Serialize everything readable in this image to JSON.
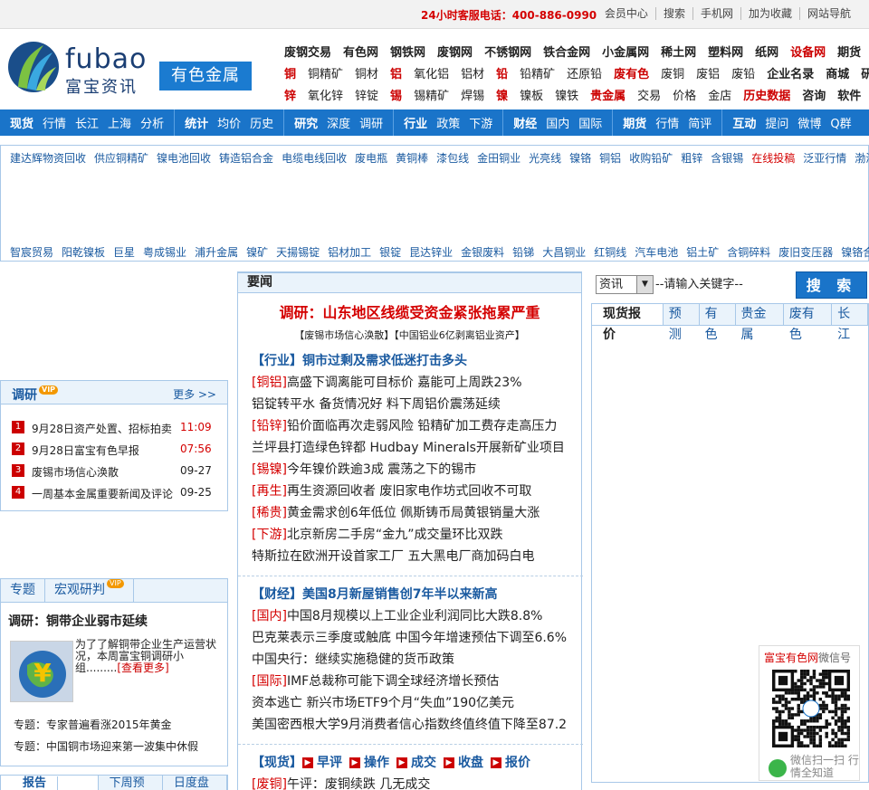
{
  "topbar": {
    "hotline": "24小时客服电话：400-886-0990",
    "links": [
      "会员中心",
      "搜索",
      "手机网",
      "加为收藏",
      "网站导航"
    ]
  },
  "logo": {
    "latin": "fubao",
    "chinese": "富宝资讯",
    "badge": "有色金属"
  },
  "topnav": {
    "row1": [
      {
        "t": "废钢交易",
        "s": "b"
      },
      {
        "t": "有色网",
        "s": "b"
      },
      {
        "t": "钢铁网",
        "s": "b"
      },
      {
        "t": "废钢网",
        "s": "b"
      },
      {
        "t": "不锈钢网",
        "s": "b"
      },
      {
        "t": "铁合金网",
        "s": "b"
      },
      {
        "t": "小金属网",
        "s": "b"
      },
      {
        "t": "稀土网",
        "s": "b"
      },
      {
        "t": "塑料网",
        "s": "b"
      },
      {
        "t": "纸网",
        "s": "b"
      },
      {
        "t": "设备网",
        "s": "br"
      },
      {
        "t": "期货",
        "s": "b"
      }
    ],
    "row2": [
      {
        "t": "铜",
        "s": "br"
      },
      {
        "t": "铜精矿",
        "s": ""
      },
      {
        "t": "铜材",
        "s": ""
      },
      {
        "t": "铝",
        "s": "br"
      },
      {
        "t": "氧化铝",
        "s": ""
      },
      {
        "t": "铝材",
        "s": ""
      },
      {
        "t": "铅",
        "s": "br"
      },
      {
        "t": "铅精矿",
        "s": ""
      },
      {
        "t": "还原铅",
        "s": ""
      },
      {
        "t": "废有色",
        "s": "br"
      },
      {
        "t": "废铜",
        "s": ""
      },
      {
        "t": "废铝",
        "s": ""
      },
      {
        "t": "废铅",
        "s": ""
      },
      {
        "t": "企业名录",
        "s": "b"
      },
      {
        "t": "商城",
        "s": "b"
      },
      {
        "t": "研报",
        "s": "b"
      }
    ],
    "row3": [
      {
        "t": "锌",
        "s": "br"
      },
      {
        "t": "氧化锌",
        "s": ""
      },
      {
        "t": "锌锭",
        "s": ""
      },
      {
        "t": "锡",
        "s": "br"
      },
      {
        "t": "锡精矿",
        "s": ""
      },
      {
        "t": "焊锡",
        "s": ""
      },
      {
        "t": "镍",
        "s": "br"
      },
      {
        "t": "镍板",
        "s": ""
      },
      {
        "t": "镍铁",
        "s": ""
      },
      {
        "t": "贵金属",
        "s": "br"
      },
      {
        "t": "交易",
        "s": ""
      },
      {
        "t": "价格",
        "s": ""
      },
      {
        "t": "金店",
        "s": ""
      },
      {
        "t": "历史数据",
        "s": "br"
      },
      {
        "t": "咨询",
        "s": "b"
      },
      {
        "t": "软件",
        "s": "b"
      }
    ]
  },
  "bluenav": [
    [
      "现货",
      "行情",
      "长江",
      "上海",
      "分析"
    ],
    [
      "统计",
      "均价",
      "历史"
    ],
    [
      "研究",
      "深度",
      "调研"
    ],
    [
      "行业",
      "政策",
      "下游"
    ],
    [
      "财经",
      "国内",
      "国际"
    ],
    [
      "期货",
      "行情",
      "简评"
    ],
    [
      "互动",
      "提问",
      "微博",
      "Q群"
    ]
  ],
  "keywords": {
    "row1": [
      "建达辉物资回收",
      "供应铜精矿",
      "镍电池回收",
      "铸造铝合金",
      "电缆电线回收",
      "废电瓶",
      "黄铜棒",
      "漆包线",
      "金田铜业",
      "光亮线",
      "镍铬",
      "铜铝",
      "收购铅矿",
      "粗锌",
      "含银锡",
      "在线投稿",
      "泛亚行情",
      "渤海"
    ],
    "row2": [
      "智宸贸易",
      "阳乾镍板",
      "巨星",
      "粤成锡业",
      "浦升金属",
      "镍矿",
      "天揚锡锭",
      "铝材加工",
      "银锭",
      "昆达锌业",
      "金银废料",
      "铅锑",
      "大昌铜业",
      "红铜线",
      "汽车电池",
      "铝土矿",
      "含铜碎料",
      "废旧变压器",
      "镍铬合金板"
    ],
    "highlight": "在线投稿"
  },
  "research": {
    "title": "调研",
    "vip": "VIP",
    "more": "更多 >>",
    "items": [
      {
        "num": "1",
        "title": "9月28日资产处置、招标拍卖",
        "date": "11:09",
        "hot": true
      },
      {
        "num": "2",
        "title": "9月28日富宝有色早报",
        "date": "07:56",
        "hot": true
      },
      {
        "num": "3",
        "title": "废锡市场信心涣散",
        "date": "09-27",
        "hot": false
      },
      {
        "num": "4",
        "title": "一周基本金属重要新闻及评论",
        "date": "09-25",
        "hot": false
      }
    ]
  },
  "topics": {
    "tab1": "专题",
    "tab2": "宏观研判",
    "vip": "VIP",
    "headline": "调研：铜带企业弱市延续",
    "desc": "为了了解铜带企业生产运营状况，本周富宝铜调研小组.........",
    "more": "[查看更多]",
    "sub1": "专题：专家普遍看涨2015年黄金",
    "sub2": "专题：中国铜市场迎来第一波集中休假"
  },
  "report_tabs": [
    "报告",
    "下周预测",
    "日度盘点"
  ],
  "middle": {
    "header": "要闻",
    "headline": "调研：山东地区线缆受资金紧张拖累严重",
    "subline": "【废锡市场信心涣散】【中国铝业6亿剥离铝业资产】",
    "sec1_title": "【行业】铜市过剩及需求低迷打击多头",
    "sec1": [
      {
        "tag": "[铜铝]",
        "text": "高盛下调离能可目标价 嘉能可上周跌23%"
      },
      {
        "tag": "",
        "text": "铝锭转平水 备货情况好 料下周铝价震荡延续"
      },
      {
        "tag": "[铅锌]",
        "text": "铅价面临再次走弱风险 铅精矿加工费存走高压力"
      },
      {
        "tag": "",
        "text": "兰坪县打造绿色锌都 Hudbay Minerals开展新矿业项目"
      },
      {
        "tag": "[锡镍]",
        "text": "今年镍价跌逾3成 震荡之下的锡市"
      },
      {
        "tag": "[再生]",
        "text": "再生资源回收者 废旧家电作坊式回收不可取"
      },
      {
        "tag": "[稀贵]",
        "text": "黄金需求创6年低位 佩斯铸币局黄银销量大涨"
      },
      {
        "tag": "[下游]",
        "text": "北京新房二手房“金九”成交量环比双跌"
      },
      {
        "tag": "",
        "text": "特斯拉在欧洲开设首家工厂 五大黑电厂商加码白电"
      }
    ],
    "sec2_title": "【财经】美国8月新屋销售创7年半以来新高",
    "sec2": [
      {
        "tag": "[国内]",
        "text": "中国8月规模以上工业企业利润同比大跌8.8%"
      },
      {
        "tag": "",
        "text": "巴克莱表示三季度或触底 中国今年增速预估下调至6.6%"
      },
      {
        "tag": "",
        "text": "中国央行：继续实施稳健的货币政策"
      },
      {
        "tag": "[国际]",
        "text": "IMF总裁称可能下调全球经济增长预估"
      },
      {
        "tag": "",
        "text": "资本逃亡 新兴市场ETF9个月“失血”190亿美元"
      },
      {
        "tag": "",
        "text": "美国密西根大学9月消费者信心指数终值终值下降至87.2"
      }
    ],
    "sec3_prefix": "【现货】",
    "sec3_links": [
      "早评",
      "操作",
      "成交",
      "收盘",
      "报价"
    ],
    "sec3_line": {
      "tag": "[废铜]",
      "text": "午评：废铜续跌 几无成交"
    }
  },
  "search": {
    "select": "资讯",
    "placeholder": "--请输入关键字--",
    "button": "搜 索"
  },
  "spot": {
    "tabs": [
      "现货报价",
      "预测",
      "有色",
      "贵金属",
      "废有色",
      "长江"
    ]
  },
  "wechat": {
    "title": "富宝有色网",
    "title_suffix": "微信号",
    "caption": "微信扫一扫 行情全知道"
  }
}
